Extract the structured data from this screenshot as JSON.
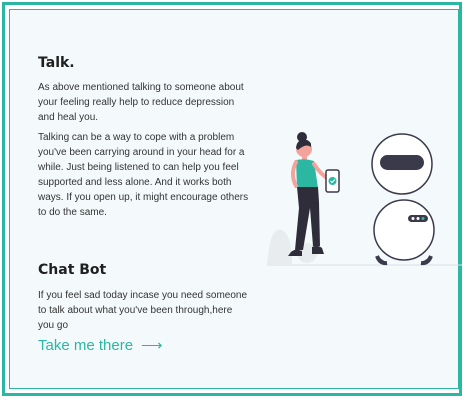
{
  "talk": {
    "title": "Talk.",
    "paragraph1": "As above mentioned talking to someone about your feeling really help to reduce depression and heal you.",
    "paragraph2": "Talking can be a way to cope with a problem you've been carrying around in your head for a while. Just being listened to can help you feel supported and less alone. And it works both ways. If you open up, it might encourage others to do the same."
  },
  "chatbot": {
    "title": "Chat Bot",
    "paragraph": "If you feel sad today incase you need someone to talk about what you've been through,here you go",
    "cta_label": "Take me there",
    "cta_icon": "arrow-right-icon"
  },
  "colors": {
    "accent": "#2bb7a1",
    "robot_dark": "#3b3a4a",
    "skin": "#f2a39c"
  }
}
